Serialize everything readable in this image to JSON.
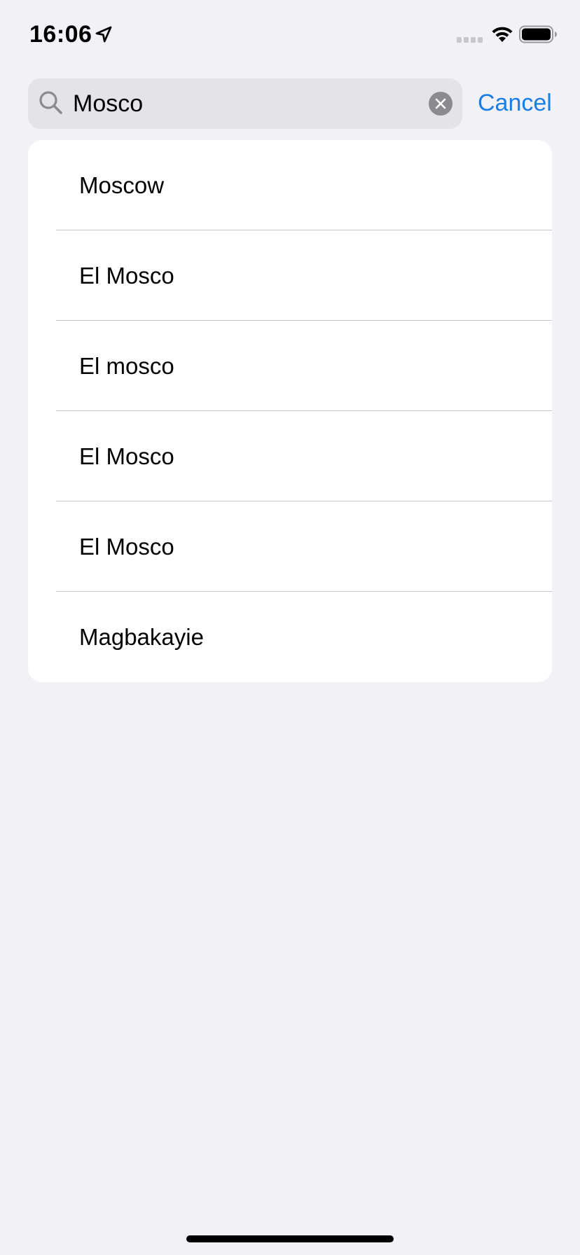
{
  "status_bar": {
    "time": "16:06",
    "icons": [
      "location-arrow-icon",
      "cellular-signal-icon",
      "wifi-icon",
      "battery-icon"
    ]
  },
  "search": {
    "value": "Mosco",
    "clear_icon": "clear-x-icon",
    "search_icon": "magnifier-icon"
  },
  "cancel_label": "Cancel",
  "results": [
    {
      "label": "Moscow"
    },
    {
      "label": "El Mosco"
    },
    {
      "label": "El mosco"
    },
    {
      "label": "El Mosco"
    },
    {
      "label": "El Mosco"
    },
    {
      "label": "Magbakayie"
    }
  ],
  "colors": {
    "background": "#f1f1f6",
    "accent": "#1a7ee8",
    "search_field": "#e3e3e8",
    "card": "#ffffff",
    "divider": "#c6c6c8"
  }
}
